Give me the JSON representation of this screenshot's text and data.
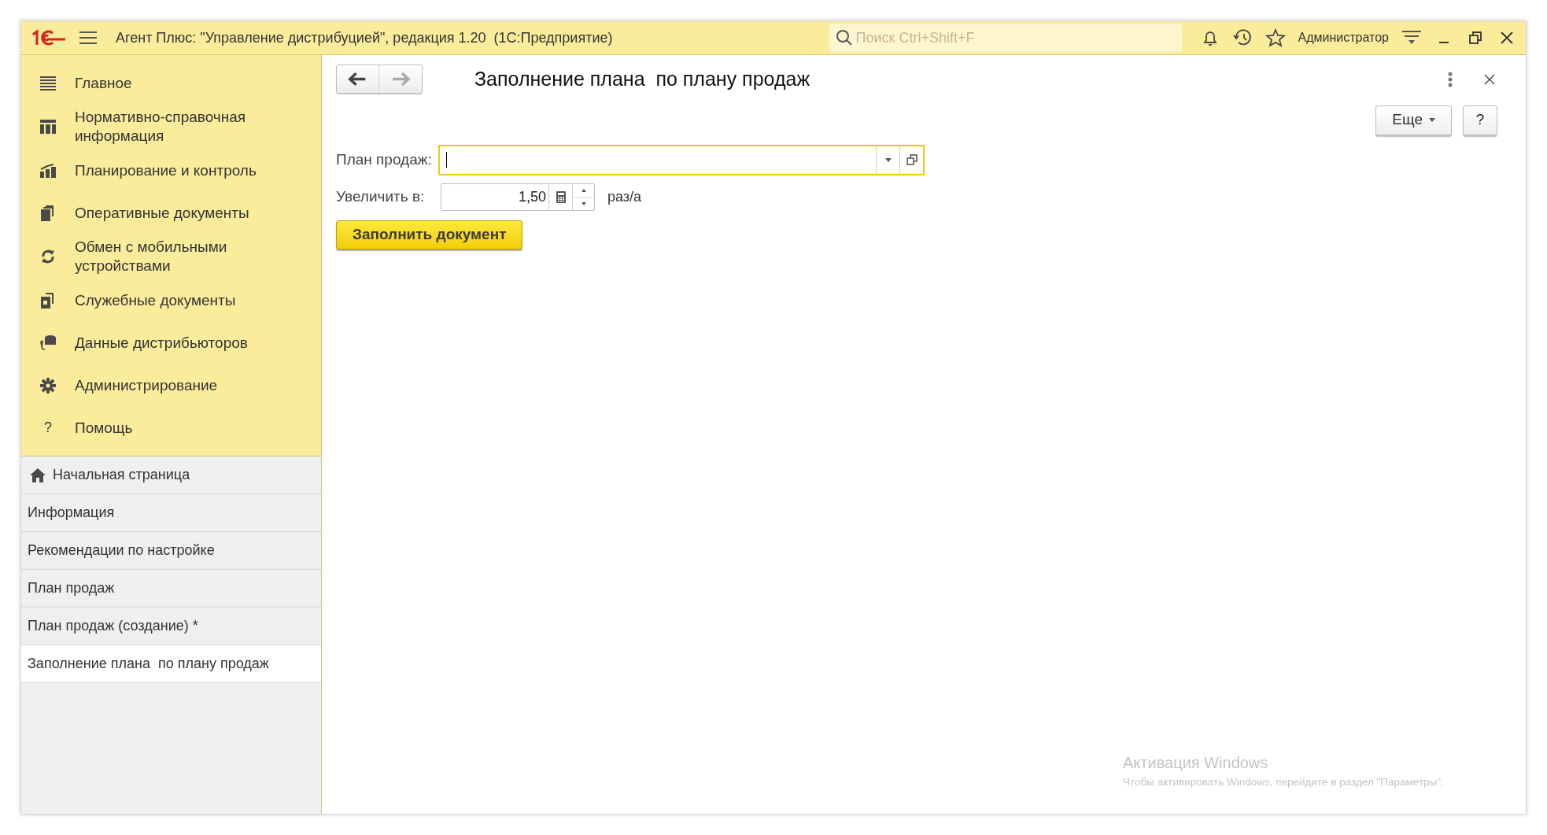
{
  "title_bar": {
    "title": "Агент Плюс: \"Управление дистрибуцией\", редакция 1.20  (1С:Предприятие)",
    "search": {
      "placeholder": "Поиск Ctrl+Shift+F"
    },
    "user": "Администратор"
  },
  "sections": [
    {
      "label": "Главное",
      "kind": "menu"
    },
    {
      "label": "Нормативно-справочная информация",
      "kind": "catalog"
    },
    {
      "label": "Планирование и контроль",
      "kind": "chart"
    },
    {
      "label": "Оперативные документы",
      "kind": "docs"
    },
    {
      "label": "Обмен с мобильными устройствами",
      "kind": "sync"
    },
    {
      "label": "Служебные документы",
      "kind": "service"
    },
    {
      "label": "Данные дистрибьюторов",
      "kind": "database"
    },
    {
      "label": "Администрирование",
      "kind": "gear"
    },
    {
      "label": "Помощь",
      "kind": "help"
    }
  ],
  "help_glyph": "?",
  "open_windows": [
    {
      "label": "Начальная страница",
      "kind": "home",
      "selected": false
    },
    {
      "label": "Информация",
      "kind": "page",
      "selected": false
    },
    {
      "label": "Рекомендации по настройке",
      "kind": "page",
      "selected": false
    },
    {
      "label": "План продаж",
      "kind": "page",
      "selected": false
    },
    {
      "label": "План продаж (создание) *",
      "kind": "page",
      "selected": false
    },
    {
      "label": "Заполнение плана  по плану продаж",
      "kind": "page",
      "selected": true
    }
  ],
  "form": {
    "title": "Заполнение плана  по плану продаж",
    "more_button": "Еще",
    "help_button": "?",
    "fields": [
      {
        "label": "План продаж:",
        "kind": "select",
        "focused": true
      },
      {
        "label": "Увеличить в:",
        "kind": "number",
        "value": "1,50",
        "unit": "раз/а",
        "focused": false
      }
    ],
    "submit": "Заполнить документ"
  },
  "os_overlay": {
    "title": "Активация Windows",
    "text": "Чтобы активировать Windows, перейдите в раздел \"Параметры\"."
  }
}
